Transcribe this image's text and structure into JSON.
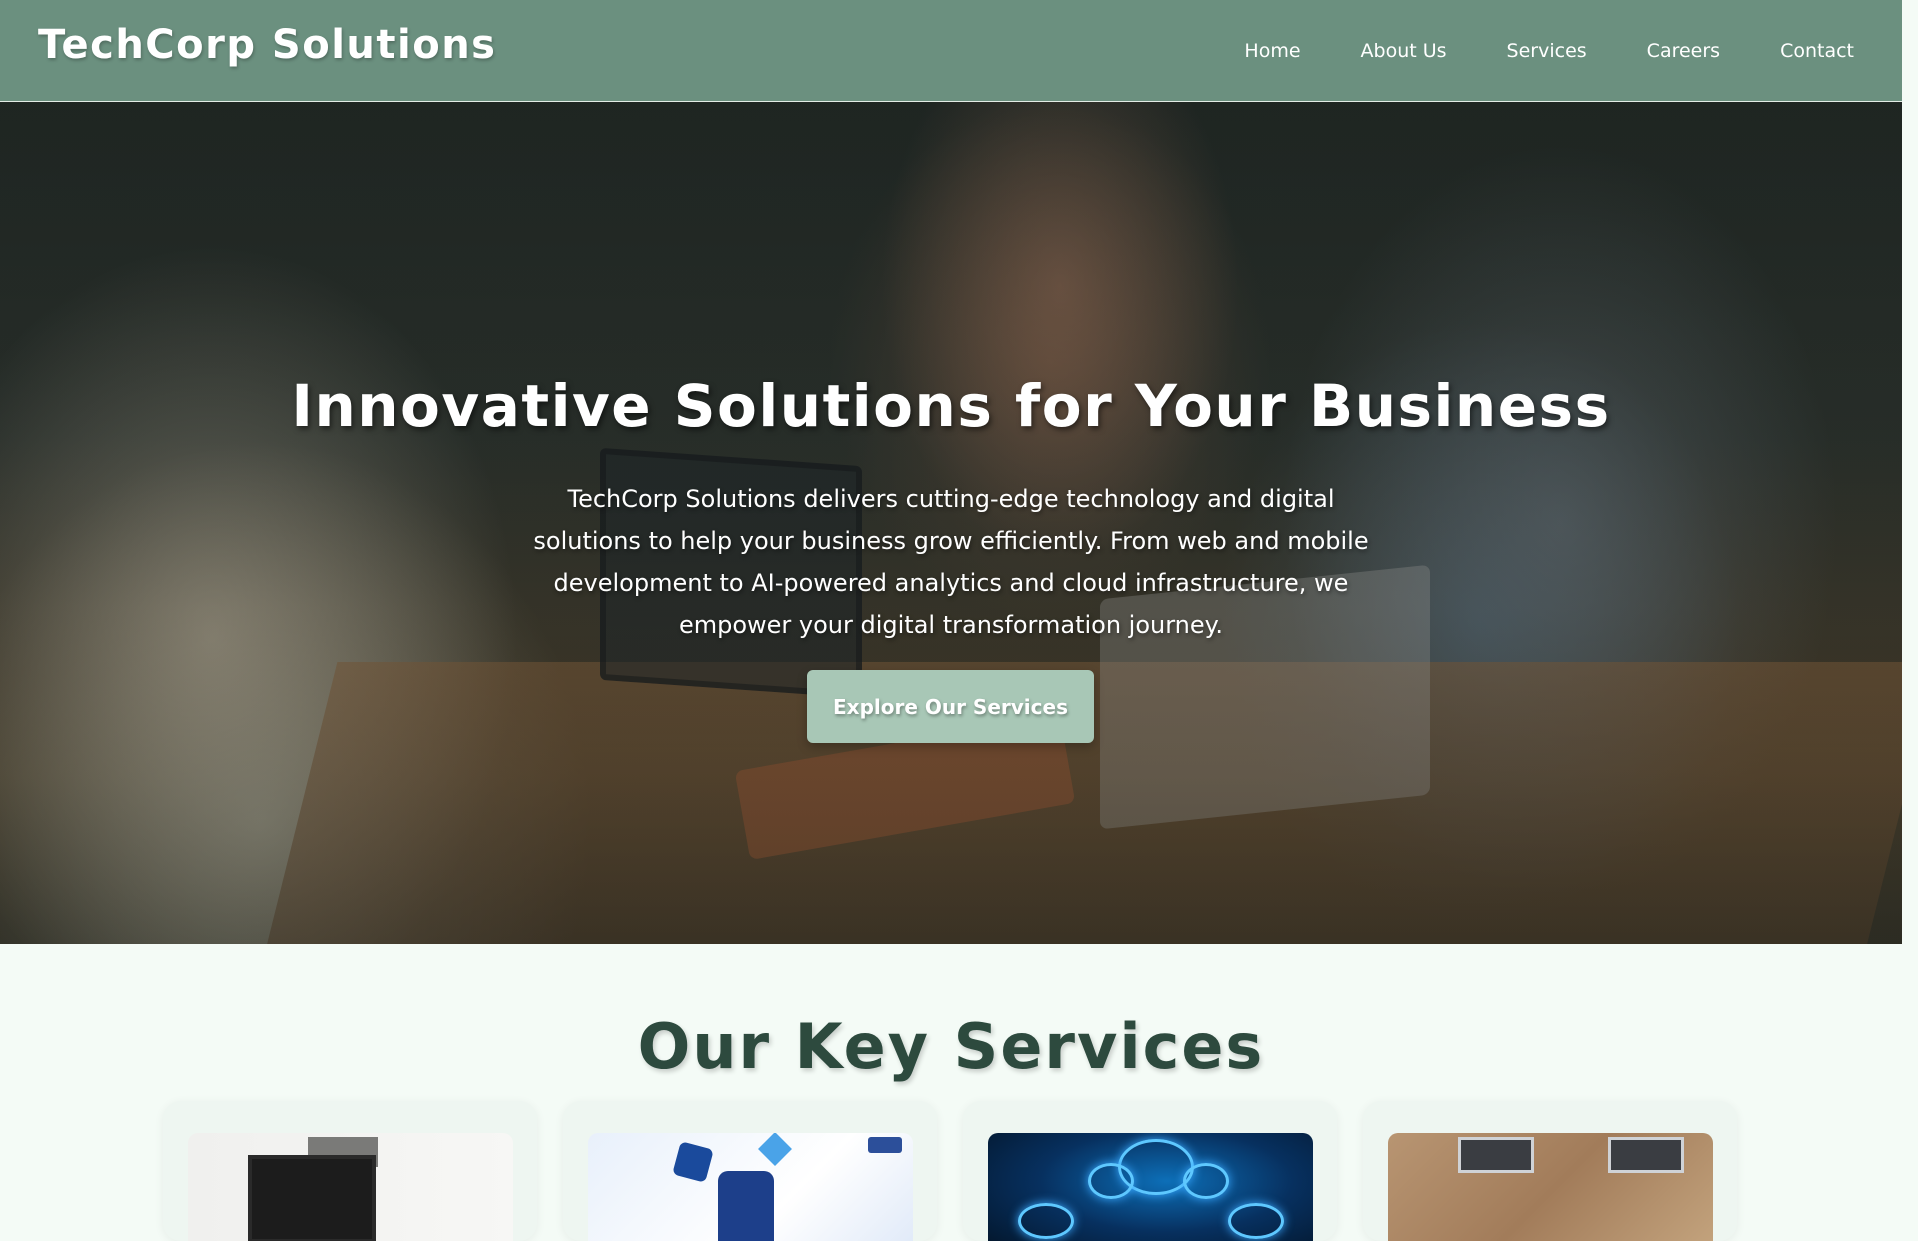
{
  "header": {
    "brand": "TechCorp Solutions",
    "nav": [
      {
        "label": "Home"
      },
      {
        "label": "About Us"
      },
      {
        "label": "Services"
      },
      {
        "label": "Careers"
      },
      {
        "label": "Contact"
      }
    ]
  },
  "hero": {
    "title": "Innovative Solutions for Your Business",
    "text": "TechCorp Solutions delivers cutting-edge technology and digital solutions to help your business grow efficiently. From web and mobile development to AI-powered analytics and cloud infrastructure, we empower your digital transformation journey.",
    "cta_label": "Explore Our Services"
  },
  "services": {
    "title": "Our Key Services"
  },
  "colors": {
    "header_bg": "#6b907f",
    "cta_bg": "#a8c7b6",
    "heading_green": "#2d4a3e",
    "page_bg": "#f4fbf6"
  }
}
